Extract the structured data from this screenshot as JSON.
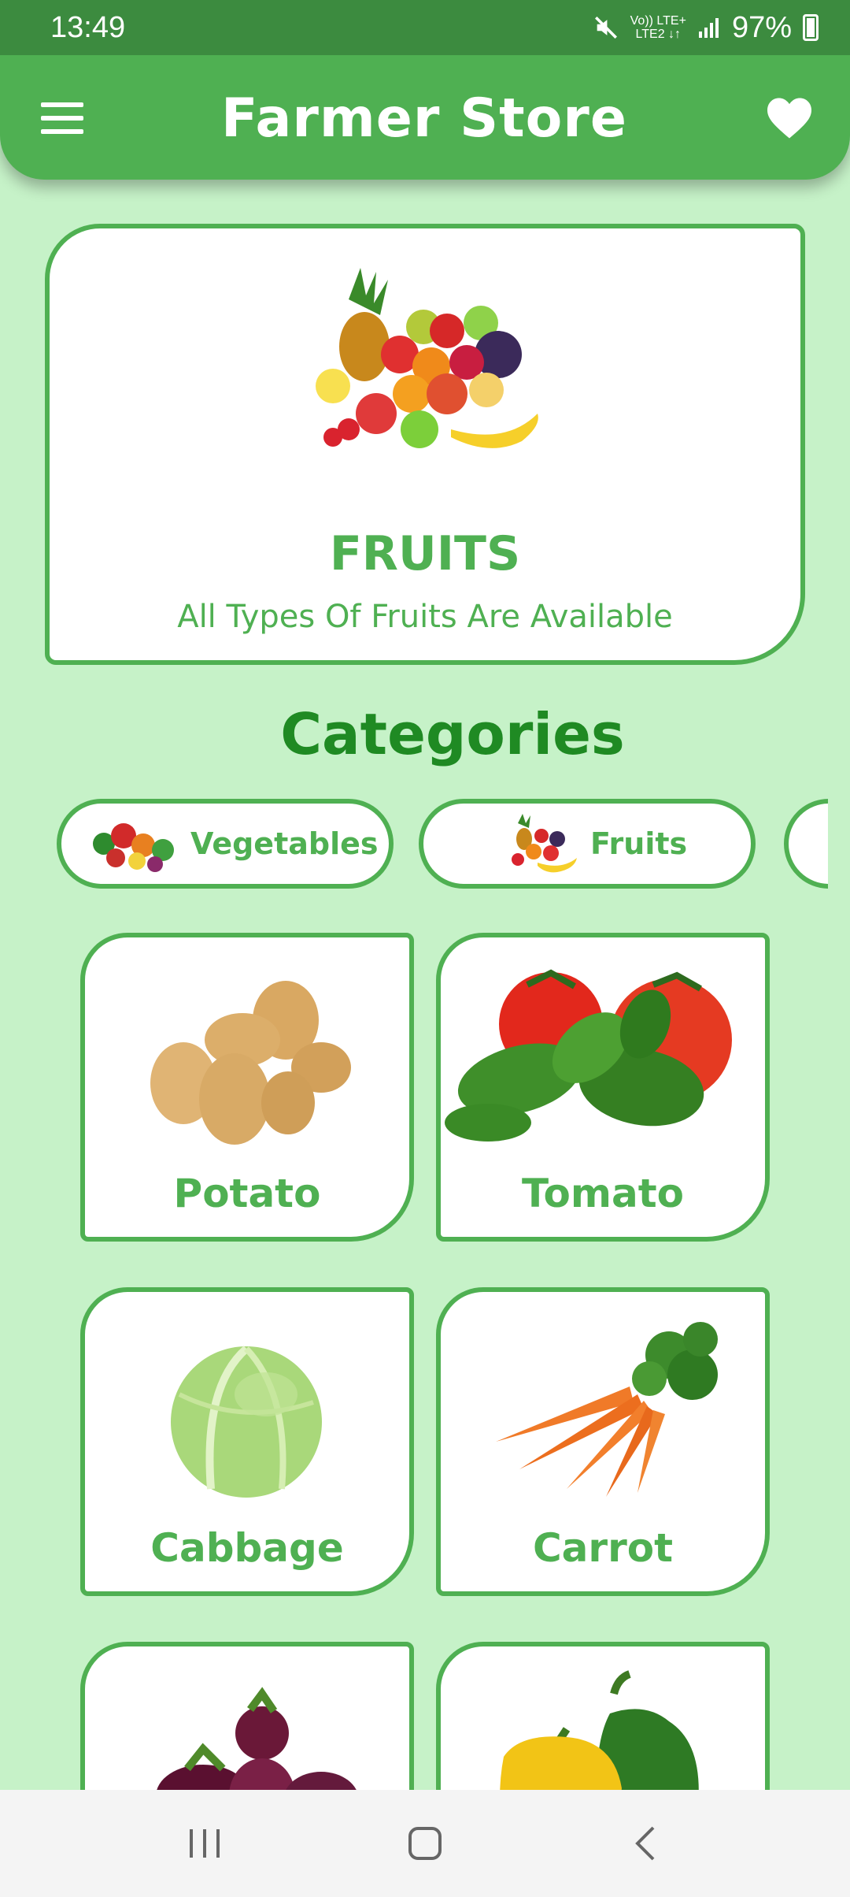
{
  "status_bar": {
    "time": "13:49",
    "network_top": "Vo)) LTE+",
    "network_bottom": "LTE2 ↓↑",
    "battery": "97%"
  },
  "app_bar": {
    "title": "Farmer Store"
  },
  "banner": {
    "title": "FRUITS",
    "subtitle": "All Types Of Fruits Are Available"
  },
  "section": {
    "title": "Categories"
  },
  "chips": [
    {
      "label": "Vegetables"
    },
    {
      "label": "Fruits"
    },
    {
      "label": ""
    }
  ],
  "products": [
    {
      "name": "Potato"
    },
    {
      "name": "Tomato"
    },
    {
      "name": "Cabbage"
    },
    {
      "name": "Carrot"
    },
    {
      "name": ""
    },
    {
      "name": ""
    }
  ],
  "colors": {
    "accent": "#4fb052",
    "dark_green": "#1f8a23",
    "background": "#c6f2c8"
  }
}
